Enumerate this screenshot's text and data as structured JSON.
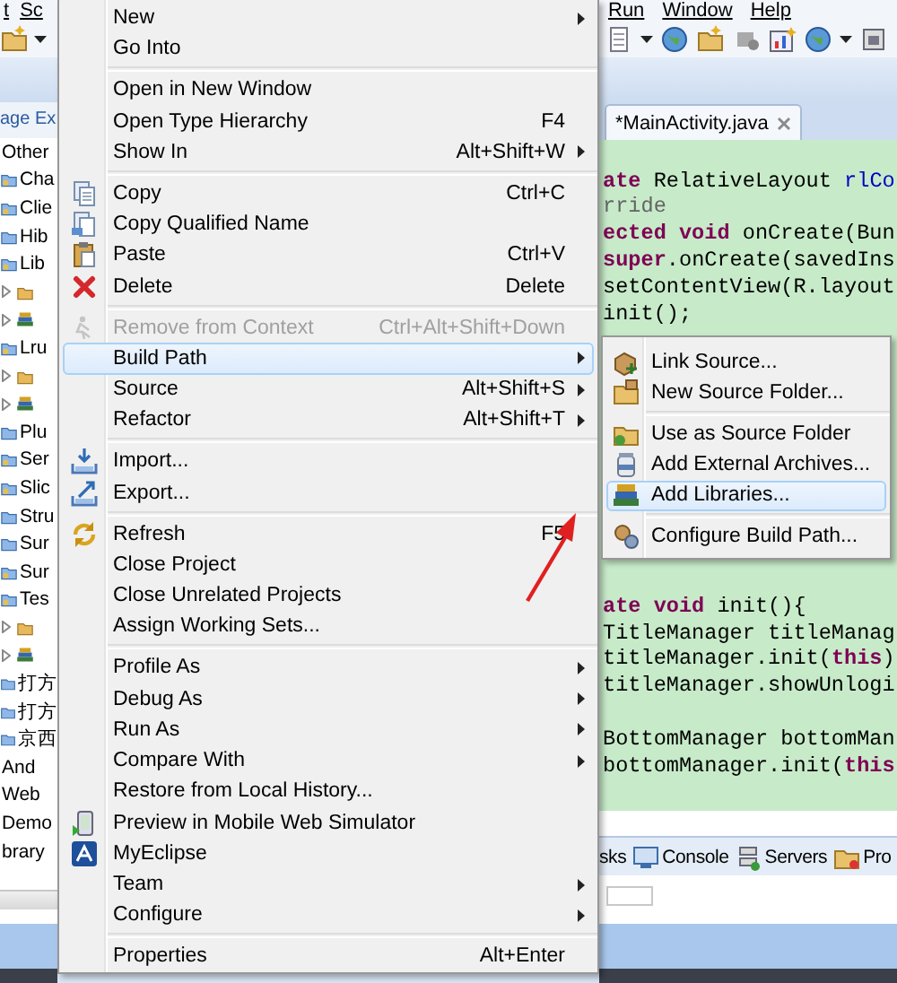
{
  "left_panel": {
    "menu": [
      "t",
      "Sc"
    ],
    "view_tab": "age Ex",
    "tree": [
      {
        "label": "Other",
        "kind": "text"
      },
      {
        "label": "Cha",
        "kind": "project"
      },
      {
        "label": "Clie",
        "kind": "project"
      },
      {
        "label": "Hib",
        "kind": "folder"
      },
      {
        "label": "Lib",
        "kind": "project",
        "children": [
          {
            "kind": "package"
          },
          {
            "kind": "library"
          }
        ]
      },
      {
        "label": "Lru",
        "kind": "project",
        "children": [
          {
            "kind": "package"
          },
          {
            "kind": "library"
          }
        ]
      },
      {
        "label": "Plu",
        "kind": "folder"
      },
      {
        "label": "Ser",
        "kind": "project"
      },
      {
        "label": "Slic",
        "kind": "project"
      },
      {
        "label": "Stru",
        "kind": "folder"
      },
      {
        "label": "Sur",
        "kind": "folder"
      },
      {
        "label": "Sur",
        "kind": "project"
      },
      {
        "label": "Tes",
        "kind": "project",
        "children": [
          {
            "kind": "package"
          },
          {
            "kind": "library"
          }
        ]
      },
      {
        "label": "打方",
        "kind": "folder"
      },
      {
        "label": "打方",
        "kind": "folder"
      },
      {
        "label": "京西",
        "kind": "folder"
      },
      {
        "label": "And",
        "kind": "text"
      },
      {
        "label": "Web",
        "kind": "text"
      },
      {
        "label": "Demo",
        "kind": "text"
      },
      {
        "label": "brary",
        "kind": "text"
      }
    ]
  },
  "menubar": [
    "Run",
    "Window",
    "Help"
  ],
  "editor": {
    "tab": "*MainActivity.java",
    "blocks": [
      [
        [
          {
            "text": "ate",
            "kind": "keyword"
          },
          {
            "text": " RelativeLayout ",
            "kind": "plain"
          },
          {
            "text": "rlCo",
            "kind": "field"
          }
        ],
        [
          {
            "text": "rride",
            "kind": "annotation"
          }
        ],
        [
          {
            "text": "ected void",
            "kind": "keyword"
          },
          {
            "text": " onCreate(Bun",
            "kind": "plain"
          }
        ],
        [
          {
            "text": "super",
            "kind": "keyword"
          },
          {
            "text": ".onCreate(savedIns",
            "kind": "plain"
          }
        ],
        [
          {
            "text": "setContentView(R.layout",
            "kind": "plain"
          }
        ],
        [
          {
            "text": "init();",
            "kind": "plain"
          }
        ]
      ],
      [
        [
          {
            "text": "ate void",
            "kind": "keyword"
          },
          {
            "text": " init(){",
            "kind": "plain"
          }
        ],
        [
          {
            "text": "TitleManager titleManag",
            "kind": "plain"
          }
        ],
        [
          {
            "text": "titleManager.init(",
            "kind": "plain"
          },
          {
            "text": "this",
            "kind": "keyword"
          },
          {
            "text": ")",
            "kind": "plain"
          }
        ],
        [
          {
            "text": "titleManager.showUnlogi",
            "kind": "plain"
          }
        ]
      ],
      [
        [
          {
            "text": "BottomManager bottomMan",
            "kind": "plain"
          }
        ],
        [
          {
            "text": "bottomManager.init(",
            "kind": "plain"
          },
          {
            "text": "this",
            "kind": "keyword"
          }
        ]
      ]
    ]
  },
  "bottom_tabs": [
    {
      "label": "sks",
      "kind": "text"
    },
    {
      "label": "Console",
      "kind": "console"
    },
    {
      "label": "Servers",
      "kind": "servers"
    },
    {
      "label": "Pro",
      "kind": "pro"
    }
  ],
  "context_menu": {
    "groups": [
      [
        {
          "label": "New",
          "submenu": true,
          "disabled": false,
          "selected": false
        },
        {
          "label": "Go Into",
          "submenu": false,
          "disabled": false,
          "selected": false
        }
      ],
      [
        {
          "label": "Open in New Window",
          "submenu": false,
          "disabled": false,
          "selected": false
        },
        {
          "label": "Open Type Hierarchy",
          "shortcut": "F4",
          "submenu": false,
          "disabled": false,
          "selected": false
        },
        {
          "label": "Show In",
          "shortcut": "Alt+Shift+W",
          "submenu": true,
          "disabled": false,
          "selected": false
        }
      ],
      [
        {
          "label": "Copy",
          "shortcut": "Ctrl+C",
          "kind": "copy",
          "submenu": false,
          "disabled": false,
          "selected": false
        },
        {
          "label": "Copy Qualified Name",
          "kind": "copyq",
          "submenu": false,
          "disabled": false,
          "selected": false
        },
        {
          "label": "Paste",
          "shortcut": "Ctrl+V",
          "kind": "paste",
          "submenu": false,
          "disabled": false,
          "selected": false
        },
        {
          "label": "Delete",
          "shortcut": "Delete",
          "kind": "delete",
          "submenu": false,
          "disabled": false,
          "selected": false
        }
      ],
      [
        {
          "label": "Remove from Context",
          "shortcut": "Ctrl+Alt+Shift+Down",
          "kind": "remove",
          "submenu": false,
          "disabled": true,
          "selected": false
        },
        {
          "label": "Build Path",
          "submenu": true,
          "disabled": false,
          "selected": true
        },
        {
          "label": "Source",
          "shortcut": "Alt+Shift+S",
          "submenu": true,
          "disabled": false,
          "selected": false
        },
        {
          "label": "Refactor",
          "shortcut": "Alt+Shift+T",
          "submenu": true,
          "disabled": false,
          "selected": false
        }
      ],
      [
        {
          "label": "Import...",
          "kind": "import",
          "submenu": false,
          "disabled": false,
          "selected": false
        },
        {
          "label": "Export...",
          "kind": "export",
          "submenu": false,
          "disabled": false,
          "selected": false
        }
      ],
      [
        {
          "label": "Refresh",
          "shortcut": "F5",
          "kind": "refresh",
          "submenu": false,
          "disabled": false,
          "selected": false
        },
        {
          "label": "Close Project",
          "submenu": false,
          "disabled": false,
          "selected": false
        },
        {
          "label": "Close Unrelated Projects",
          "submenu": false,
          "disabled": false,
          "selected": false
        },
        {
          "label": "Assign Working Sets...",
          "submenu": false,
          "disabled": false,
          "selected": false
        }
      ],
      [
        {
          "label": "Profile As",
          "submenu": true,
          "disabled": false,
          "selected": false
        },
        {
          "label": "Debug As",
          "submenu": true,
          "disabled": false,
          "selected": false
        },
        {
          "label": "Run As",
          "submenu": true,
          "disabled": false,
          "selected": false
        },
        {
          "label": "Compare With",
          "submenu": true,
          "disabled": false,
          "selected": false
        },
        {
          "label": "Restore from Local History...",
          "submenu": false,
          "disabled": false,
          "selected": false
        },
        {
          "label": "Preview in Mobile Web Simulator",
          "kind": "preview",
          "submenu": false,
          "disabled": false,
          "selected": false
        },
        {
          "label": "MyEclipse",
          "kind": "myeclipse",
          "submenu": false,
          "disabled": false,
          "selected": false
        },
        {
          "label": "Team",
          "submenu": true,
          "disabled": false,
          "selected": false
        },
        {
          "label": "Configure",
          "submenu": true,
          "disabled": false,
          "selected": false
        }
      ],
      [
        {
          "label": "Properties",
          "shortcut": "Alt+Enter",
          "submenu": false,
          "disabled": false,
          "selected": false
        }
      ]
    ]
  },
  "submenu": {
    "groups": [
      [
        {
          "label": "Link Source...",
          "kind": "link",
          "selected": false
        },
        {
          "label": "New Source Folder...",
          "kind": "newsrc",
          "selected": false
        }
      ],
      [
        {
          "label": "Use as Source Folder",
          "kind": "usesrc",
          "selected": false
        },
        {
          "label": "Add External Archives...",
          "kind": "archive",
          "selected": false
        },
        {
          "label": "Add Libraries...",
          "kind": "libraries",
          "selected": true
        }
      ],
      [
        {
          "label": "Configure Build Path...",
          "kind": "configure",
          "selected": false
        }
      ]
    ]
  }
}
